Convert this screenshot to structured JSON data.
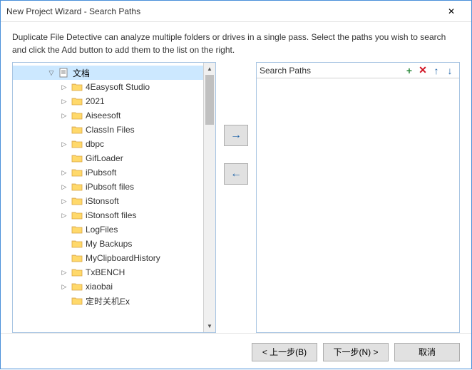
{
  "window": {
    "title": "New Project Wizard - Search Paths"
  },
  "description": "Duplicate File Detective can analyze multiple folders or drives in a single pass. Select the paths you wish to search and click the Add button to add them to the list on the right.",
  "tree": {
    "root": {
      "label": "文档",
      "expanded": true,
      "selected": true,
      "icon": "doc"
    },
    "children": [
      {
        "label": "4Easysoft Studio",
        "expandable": true
      },
      {
        "label": "2021",
        "expandable": true
      },
      {
        "label": "Aiseesoft",
        "expandable": true
      },
      {
        "label": "ClassIn Files",
        "expandable": false
      },
      {
        "label": "dbpc",
        "expandable": true
      },
      {
        "label": "GifLoader",
        "expandable": false
      },
      {
        "label": "iPubsoft",
        "expandable": true
      },
      {
        "label": "iPubsoft files",
        "expandable": true
      },
      {
        "label": "iStonsoft",
        "expandable": true
      },
      {
        "label": "iStonsoft files",
        "expandable": true
      },
      {
        "label": "LogFiles",
        "expandable": false
      },
      {
        "label": "My Backups",
        "expandable": false
      },
      {
        "label": "MyClipboardHistory",
        "expandable": false
      },
      {
        "label": "TxBENCH",
        "expandable": true
      },
      {
        "label": "xiaobai",
        "expandable": true
      },
      {
        "label": "定时关机Ex",
        "expandable": false
      }
    ]
  },
  "right_panel": {
    "title": "Search Paths"
  },
  "buttons": {
    "add_right": "→",
    "add_left": "←",
    "prev": "< 上一步(B)",
    "next": "下一步(N) >",
    "cancel": "取消"
  },
  "icons": {
    "close": "✕",
    "expand_closed": "▷",
    "expand_open": "▽",
    "plus": "+",
    "delete": "✕",
    "up": "↑",
    "down": "↓",
    "scroll_up": "▲",
    "scroll_down": "▼"
  }
}
